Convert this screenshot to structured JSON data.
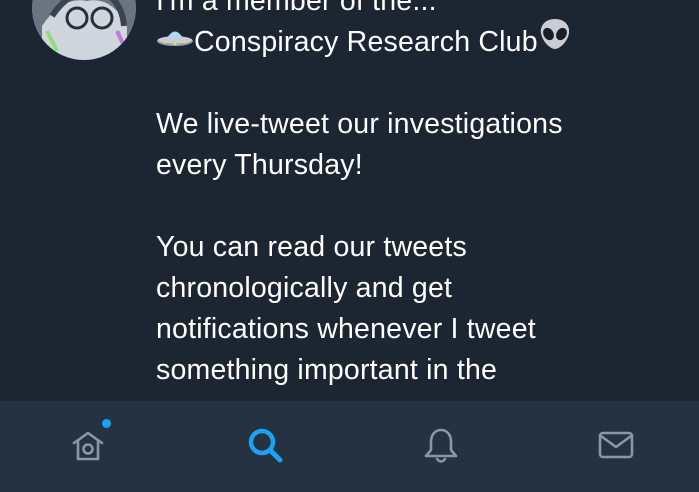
{
  "tweet": {
    "line_0": "I'm a member of the...",
    "line_1": "Conspiracy Research Club",
    "line_2": "We live-tweet our investigations",
    "line_3": "every Thursday!",
    "line_4": "You can read our tweets",
    "line_5": "chronologically and get",
    "line_6": "notifications whenever I tweet",
    "line_7": "something important in the"
  },
  "icons": {
    "ufo": "ufo-emoji",
    "alien": "alien-emoji",
    "home": "home-icon",
    "search": "search-icon",
    "notifications": "bell-icon",
    "messages": "mail-icon"
  },
  "colors": {
    "background": "#1c2532",
    "tab_bar": "#253241",
    "text": "#ffffff",
    "accent": "#1da1f2",
    "inactive_icon": "#8899a6"
  },
  "tab_bar": {
    "active_tab": "search",
    "home_has_notification_dot": true
  }
}
